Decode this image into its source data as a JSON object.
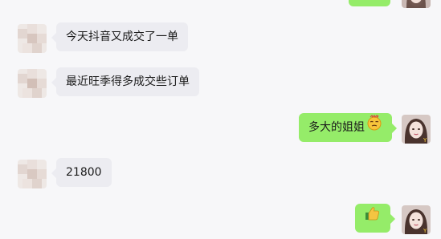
{
  "colors": {
    "background": "#f7f7f9",
    "incoming_bubble": "#ececf1",
    "outgoing_bubble": "#95ec69",
    "text": "#1b1b1b"
  },
  "messages": [
    {
      "direction": "incoming",
      "text": "今天抖音又成交了一单"
    },
    {
      "direction": "incoming",
      "text": "最近旺季得多成交些订单"
    },
    {
      "direction": "outgoing",
      "text": "多大的姐姐",
      "emoji": "lazy-face-emoji"
    },
    {
      "direction": "incoming",
      "text": "21800"
    },
    {
      "direction": "outgoing",
      "text": "",
      "emoji": "thumbs-up-emoji"
    }
  ]
}
